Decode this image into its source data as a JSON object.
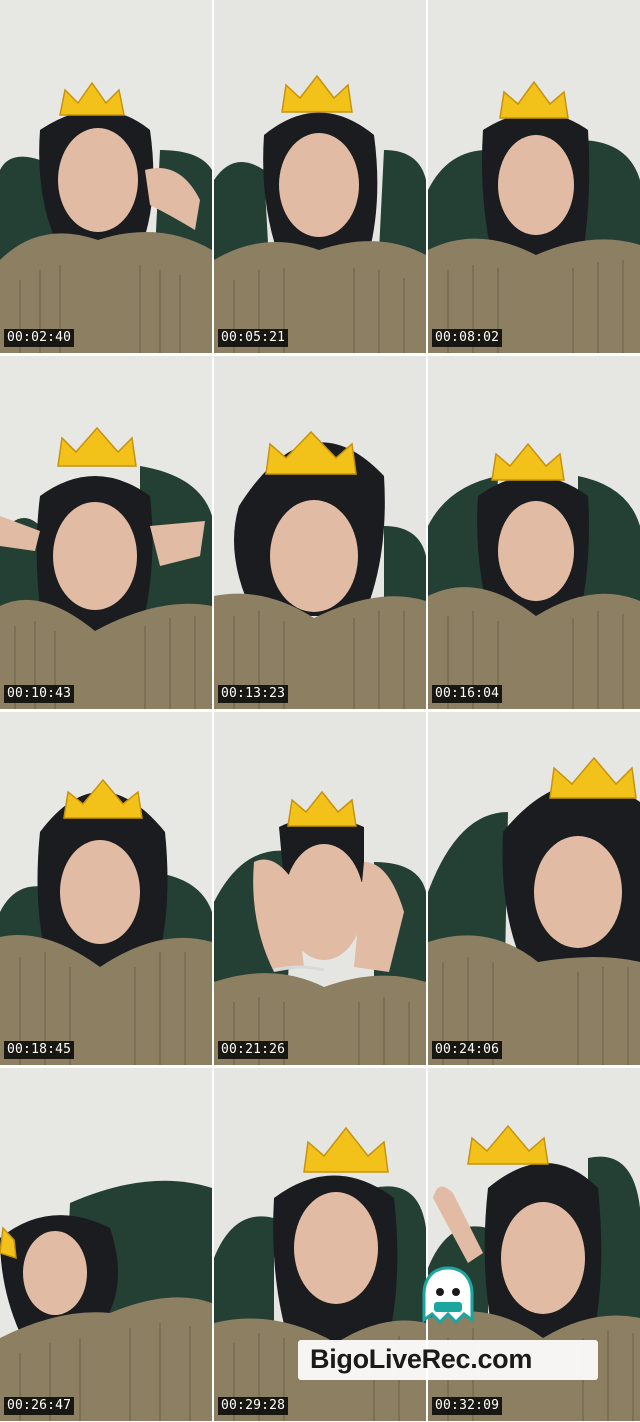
{
  "contact_sheet": {
    "columns": 3,
    "rows": 4,
    "frames": [
      {
        "timestamp": "00:02:40"
      },
      {
        "timestamp": "00:05:21"
      },
      {
        "timestamp": "00:08:02"
      },
      {
        "timestamp": "00:10:43"
      },
      {
        "timestamp": "00:13:23"
      },
      {
        "timestamp": "00:16:04"
      },
      {
        "timestamp": "00:18:45"
      },
      {
        "timestamp": "00:21:26"
      },
      {
        "timestamp": "00:24:06"
      },
      {
        "timestamp": "00:26:47"
      },
      {
        "timestamp": "00:29:28"
      },
      {
        "timestamp": "00:32:09"
      }
    ]
  },
  "watermark": {
    "text": "BigoLiveRec.com",
    "mascot_icon": "ghost-mascot-icon"
  },
  "colors": {
    "background_wall": "#e6e6e2",
    "chair": "#244034",
    "sweater": "#8c7f62",
    "hijab": "#1b1c1f",
    "skin": "#e2bba4",
    "crown": "#f2c21b",
    "timestamp_bg": "#000000",
    "timestamp_text": "#ffffff"
  }
}
